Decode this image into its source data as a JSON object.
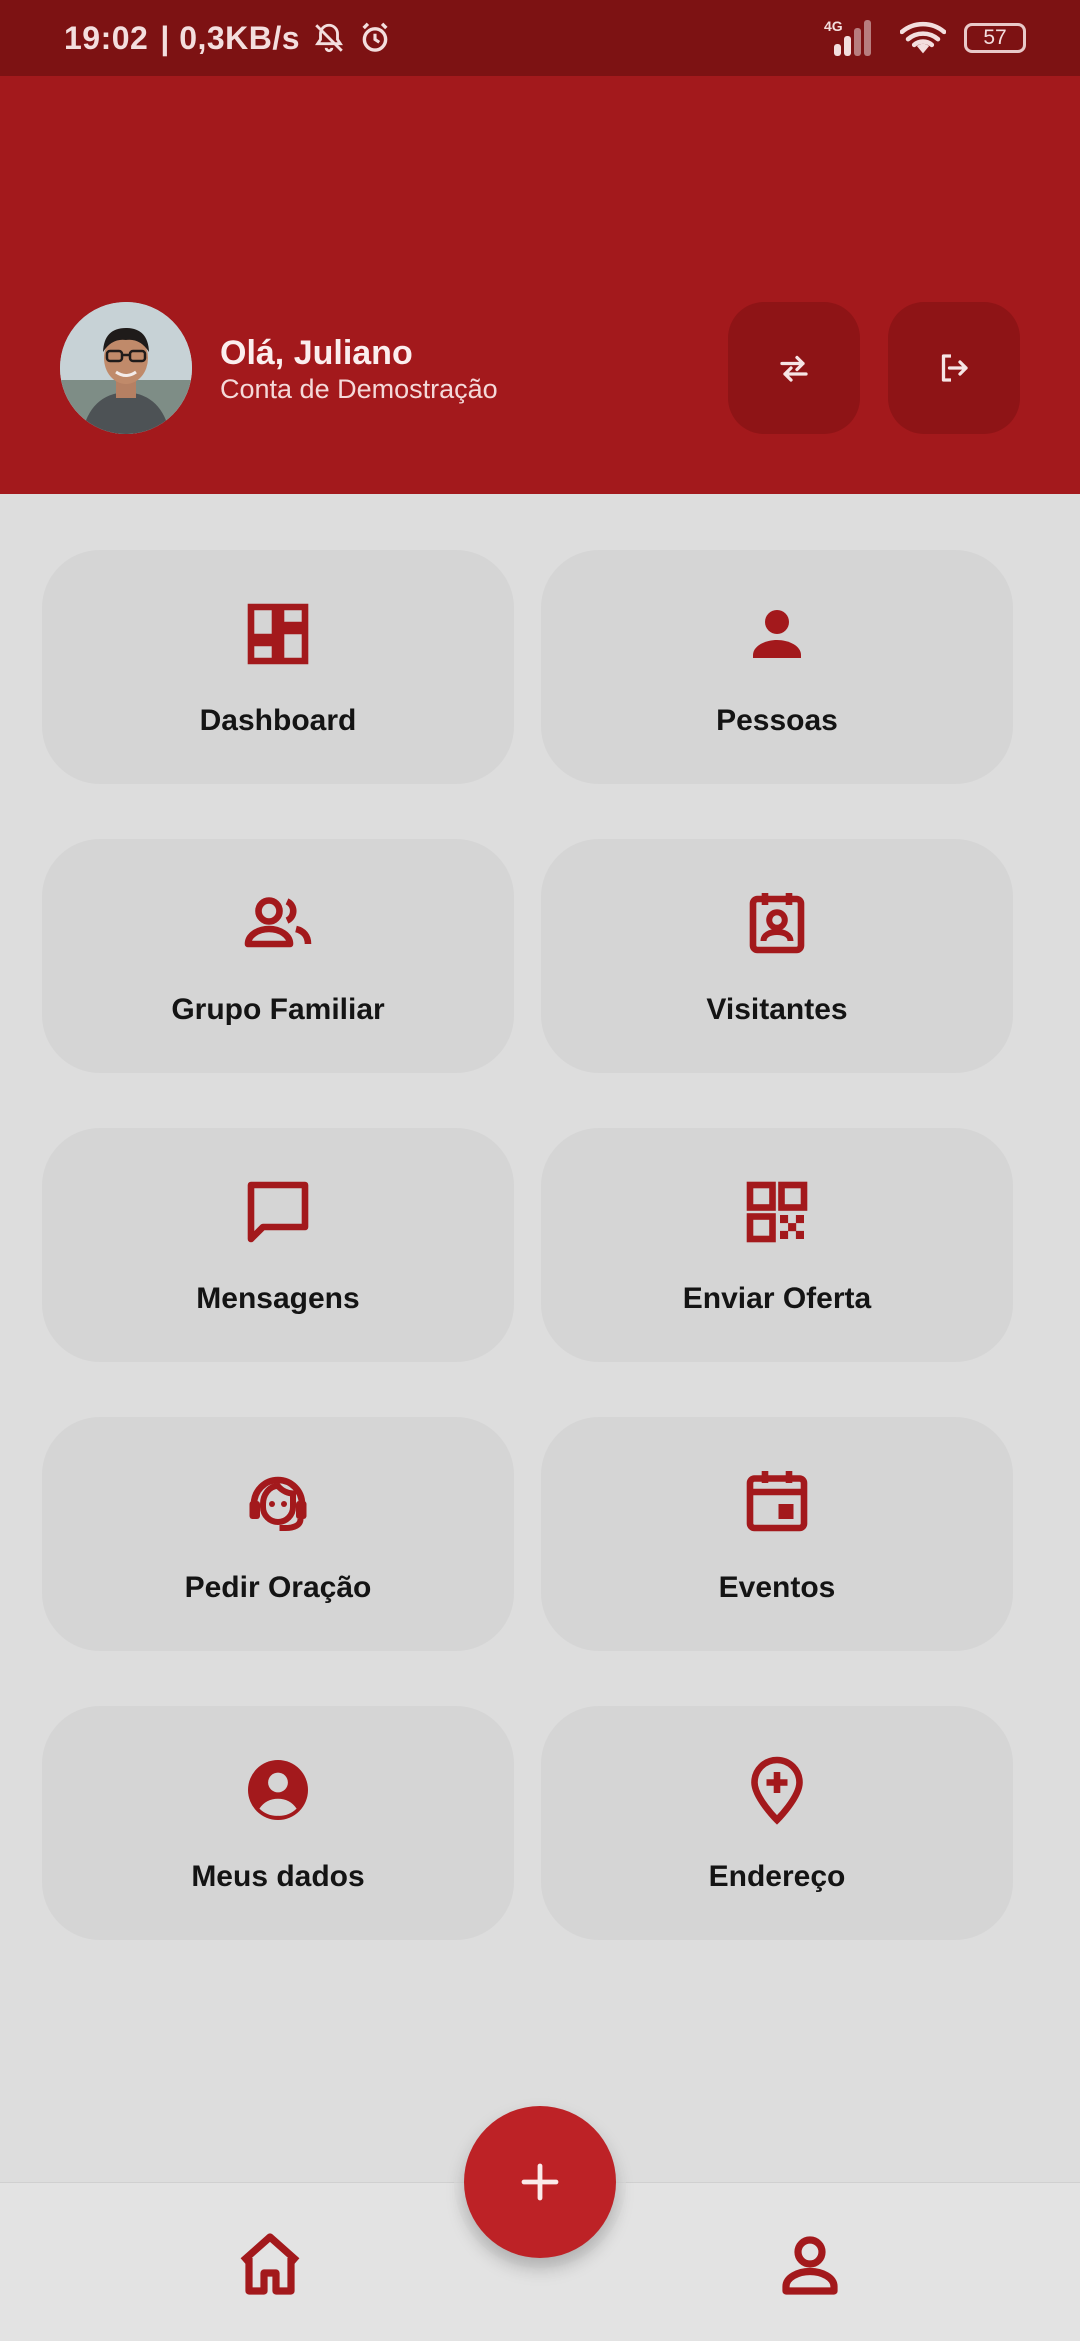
{
  "status_bar": {
    "time": "19:02",
    "speed": "| 0,3KB/s",
    "network": "4G",
    "battery": "57"
  },
  "header": {
    "greeting": "Olá, Juliano",
    "account": "Conta de Demostração"
  },
  "menu": [
    {
      "label": "Dashboard",
      "icon": "dashboard-icon"
    },
    {
      "label": "Pessoas",
      "icon": "person-icon"
    },
    {
      "label": "Grupo Familiar",
      "icon": "group-icon"
    },
    {
      "label": "Visitantes",
      "icon": "badge-icon"
    },
    {
      "label": "Mensagens",
      "icon": "chat-icon"
    },
    {
      "label": "Enviar Oferta",
      "icon": "qr-code-icon"
    },
    {
      "label": "Pedir Oração",
      "icon": "support-agent-icon"
    },
    {
      "label": "Eventos",
      "icon": "calendar-event-icon"
    },
    {
      "label": "Meus dados",
      "icon": "account-circle-icon"
    },
    {
      "label": "Endereço",
      "icon": "add-location-icon"
    }
  ],
  "colors": {
    "primary": "#a3191c",
    "status_bar": "#7d1213",
    "fab": "#bd2226",
    "background": "#dddddd",
    "tile": "#d5d5d5"
  }
}
